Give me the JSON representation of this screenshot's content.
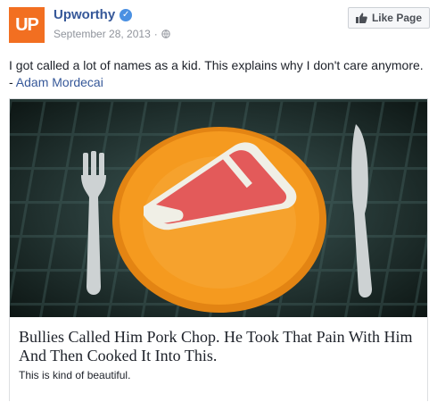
{
  "header": {
    "logo_text": "UP",
    "page_name": "Upworthy",
    "verified_icon": "check-icon",
    "date": "September 28, 2013",
    "separator": "·",
    "privacy_icon": "globe-icon",
    "like_button": {
      "label": "Like Page",
      "icon": "thumbs-up-icon"
    }
  },
  "post": {
    "text": "I got called a lot of names as a kid. This explains why I don't care anymore.",
    "author_prefix": "- ",
    "author": "Adam Mordecai"
  },
  "link_card": {
    "image_description_icon": "pork-chop-plate-icon",
    "title": "Bullies Called Him Pork Chop. He Took That Pain With Him And Then Cooked It Into This.",
    "description": "This is kind of beautiful."
  },
  "colors": {
    "brand_orange": "#f26f21",
    "link_blue": "#365899",
    "meta_gray": "#90949c",
    "plate_orange": "#f59a1f",
    "meat_red": "#e35a5a"
  }
}
